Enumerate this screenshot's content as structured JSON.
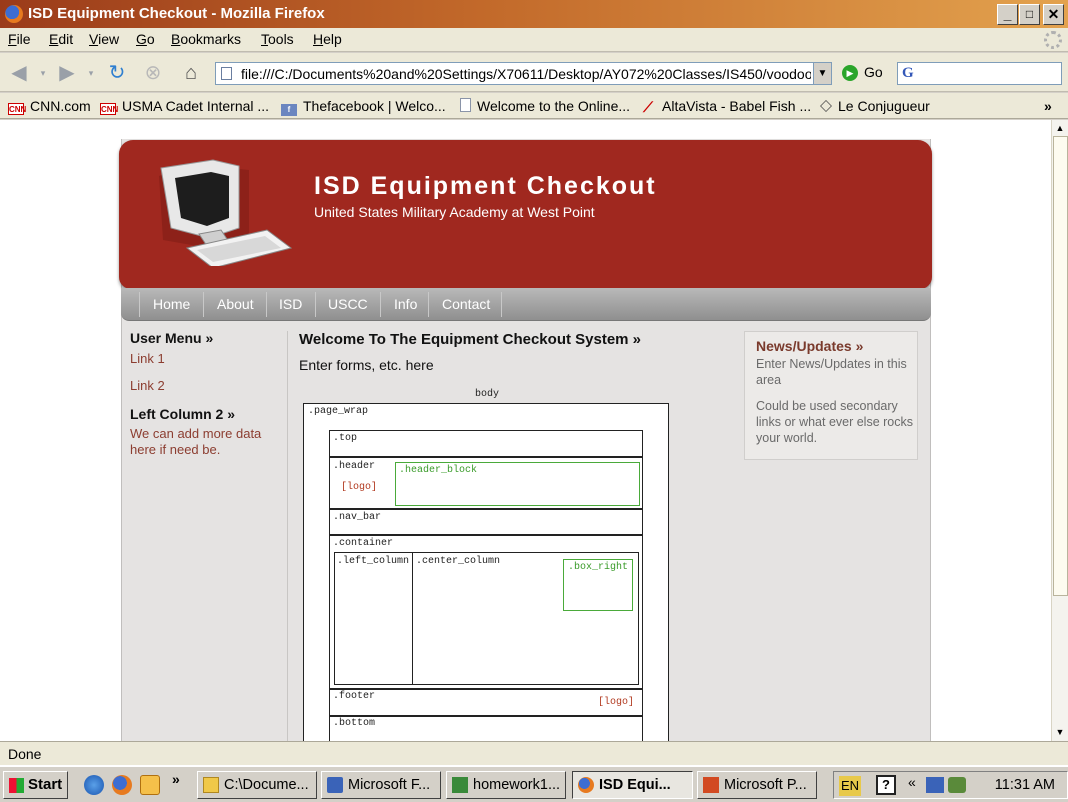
{
  "window": {
    "title": "ISD Equipment Checkout - Mozilla Firefox",
    "controls": [
      "_",
      "□",
      "✕"
    ]
  },
  "menu": [
    {
      "key": "F",
      "rest": "ile"
    },
    {
      "key": "E",
      "rest": "dit"
    },
    {
      "key": "V",
      "rest": "iew"
    },
    {
      "key": "G",
      "rest": "o"
    },
    {
      "key": "B",
      "rest": "ookmarks"
    },
    {
      "key": "T",
      "rest": "ools"
    },
    {
      "key": "H",
      "rest": "elp"
    }
  ],
  "navigation": {
    "url": "file:///C:/Documents%20and%20Settings/X70611/Desktop/AY072%20Classes/IS450/voodoo",
    "go_label": "Go",
    "search_value": ""
  },
  "bookmarks": [
    {
      "label": "CNN.com",
      "icon": "cnn-icon"
    },
    {
      "label": "USMA Cadet Internal ...",
      "icon": "cnn-icon"
    },
    {
      "label": "Thefacebook | Welco...",
      "icon": "facebook-icon"
    },
    {
      "label": "Welcome to the Online...",
      "icon": "page-icon"
    },
    {
      "label": "AltaVista - Babel Fish ...",
      "icon": "altavista-icon"
    },
    {
      "label": "Le Conjugueur",
      "icon": "diamond-icon"
    }
  ],
  "bookmarks_more": "»",
  "page": {
    "header_title": "ISD Equipment Checkout",
    "header_subtitle": "United States Military Academy at West Point",
    "nav": [
      "Home",
      "About",
      "ISD",
      "USCC",
      "Info",
      "Contact"
    ],
    "left": {
      "menu_title": "User Menu »",
      "links": [
        "Link 1",
        "Link 2"
      ],
      "col2_title": "Left Column 2 »",
      "col2_text": "We can add more data here if need be."
    },
    "center": {
      "title": "Welcome To The Equipment Checkout System »",
      "intro": "Enter forms, etc. here"
    },
    "diagram": {
      "body": "body",
      "page_wrap": ".page_wrap",
      "top": ".top",
      "header": ".header",
      "logo": "[logo]",
      "header_block": ".header_block",
      "nav_bar": ".nav_bar",
      "container": ".container",
      "left_column": ".left_column",
      "center_column": ".center_column",
      "box_right": ".box_right",
      "footer": ".footer",
      "footer_logo": "[logo]",
      "bottom": ".bottom"
    },
    "right": {
      "title": "News/Updates »",
      "text1": "Enter News/Updates in this area",
      "text2": "Could be used secondary links or what ever else rocks your world."
    }
  },
  "status": "Done",
  "taskbar": {
    "start": "Start",
    "more": "»",
    "tasks": [
      {
        "label": "C:\\Docume...",
        "icon": "folder-icon",
        "active": false
      },
      {
        "label": "Microsoft F...",
        "icon": "frontpage-icon",
        "active": false
      },
      {
        "label": "homework1...",
        "icon": "image-icon",
        "active": false
      },
      {
        "label": "ISD Equi...",
        "icon": "firefox-icon",
        "active": true
      },
      {
        "label": "Microsoft P...",
        "icon": "powerpoint-icon",
        "active": false
      }
    ],
    "lang": "EN",
    "tray_more": "«",
    "clock": "11:31 AM"
  },
  "colors": {
    "header_red": "#a0281f",
    "link_brown": "#8c3d30",
    "diagram_green": "#4aaa3a",
    "diagram_red": "#b23a20"
  }
}
